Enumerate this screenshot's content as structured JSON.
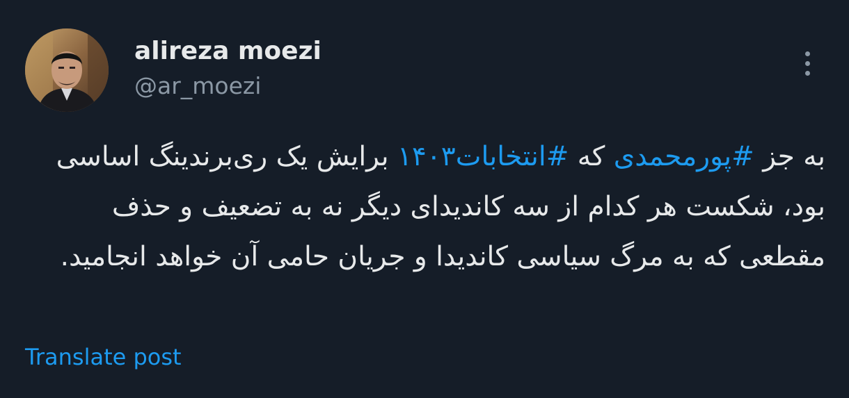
{
  "author": {
    "display_name": "alireza moezi",
    "handle": "@ar_moezi",
    "avatar_icon": "user-profile-photo"
  },
  "menu": {
    "icon": "more-vertical-icon"
  },
  "post": {
    "text_part_1": "به جز ",
    "hashtag_1": "#پورمحمدی",
    "text_part_2": " که ",
    "hashtag_2": "#انتخابات۱۴۰۳",
    "text_part_3": " برایش یک ری‌برندینگ اساسی بود، شکست هر کدام از سه کاندیدای دیگر نه به تضعیف و حذف مقطعی که به مرگ سیاسی کاندیدا و جریان حامی آن خواهد انجامید."
  },
  "actions": {
    "translate_label": "Translate post"
  },
  "colors": {
    "background": "#151d28",
    "text": "#e7e9ea",
    "secondary": "#8b98a5",
    "accent": "#1d9bf0"
  }
}
